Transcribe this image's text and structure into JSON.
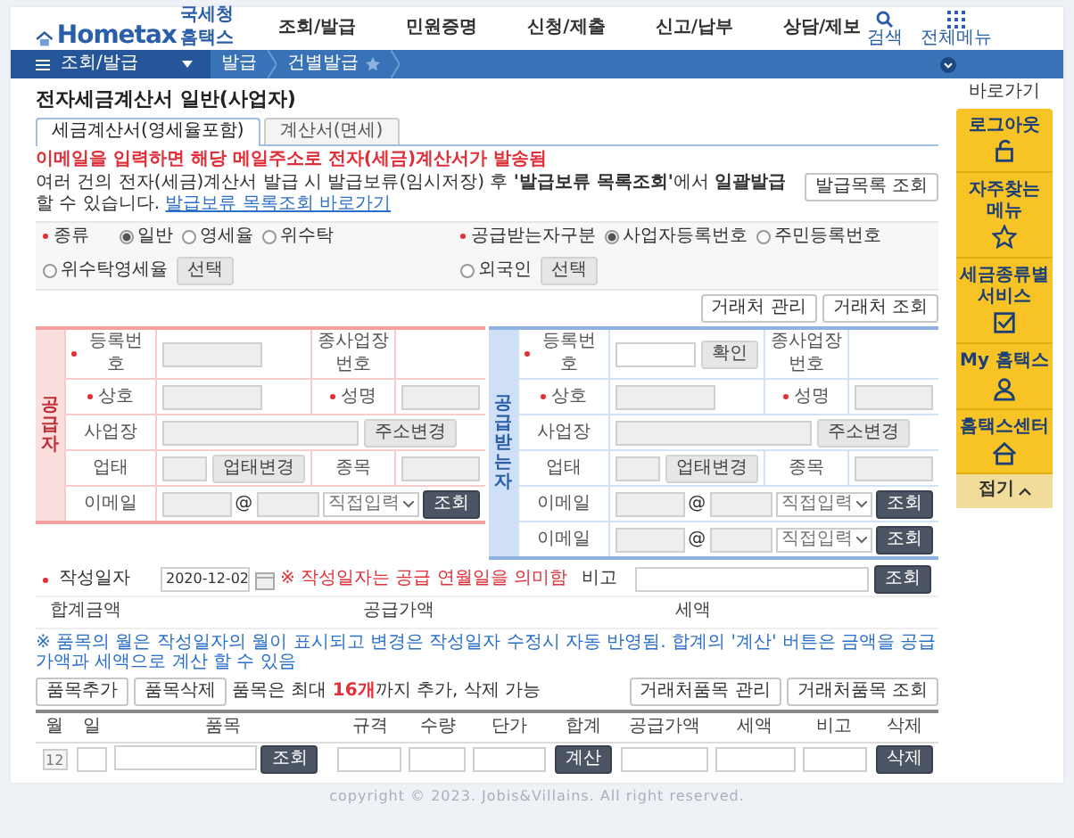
{
  "header": {
    "logo": {
      "name": "Hometax",
      "subtitle": "국세청홈택스"
    },
    "nav": [
      "조회/발급",
      "민원증명",
      "신청/제출",
      "신고/납부",
      "상담/제보"
    ],
    "utilities": [
      {
        "kind": "search",
        "label": "검색"
      },
      {
        "kind": "menu",
        "label": "전체메뉴"
      }
    ]
  },
  "breadcrumb": {
    "menu": "조회/발급",
    "items": [
      "발급",
      "건별발급"
    ]
  },
  "page_title": "전자세금계산서 일반(사업자)",
  "tabs": [
    {
      "label": "세금계산서(영세율포함)",
      "selected": true
    },
    {
      "label": "계산서(면세)",
      "selected": false
    }
  ],
  "notices": {
    "email": "이메일을 입력하면 해당 메일주소로 전자(세금)계산서가 발송됨",
    "info": "여러 건의 전자(세금)계산서 발급 시 발급보류(임시저장) 후 **'발급보류 목록조회'**에서 **일괄발급**할 수 있습니다.",
    "info_link": "발급보류 목록조회 바로가기"
  },
  "issued_list_button": "발급목록 조회",
  "invoice_type": {
    "label": "종류",
    "required": true,
    "button": "선택",
    "options": [
      {
        "label": "일반",
        "selected": true
      },
      {
        "label": "영세율",
        "selected": false
      },
      {
        "label": "위수탁",
        "selected": false
      },
      {
        "label": "위수탁영세율",
        "selected": false
      }
    ]
  },
  "recipient_type": {
    "label": "공급받는자구분",
    "required": true,
    "button": "선택",
    "options": [
      {
        "label": "사업자등록번호",
        "selected": true
      },
      {
        "label": "주민등록번호",
        "selected": false
      },
      {
        "label": "외국인",
        "selected": false
      }
    ]
  },
  "partner_buttons": [
    "거래처 관리",
    "거래처 조회"
  ],
  "parties": [
    {
      "kind": "supplier",
      "title": "공급자",
      "reg_no": {
        "label": "등록번호",
        "required": true
      },
      "sub_no": {
        "label": "종사업장번호"
      },
      "company": {
        "label": "상호",
        "required": true
      },
      "representative": {
        "label": "성명",
        "required": true
      },
      "address": {
        "label": "사업장",
        "button": "주소변경"
      },
      "business": {
        "label": "업태",
        "button": "업태변경"
      },
      "item": {
        "label": "종목"
      },
      "emails": [
        {
          "label": "이메일",
          "at": "@",
          "domain": "직접입력",
          "button": "조회"
        }
      ]
    },
    {
      "kind": "recipient",
      "title": "공급받는자",
      "reg_no": {
        "label": "등록번호",
        "required": true
      },
      "confirm_button": "확인",
      "sub_no": {
        "label": "종사업장번호"
      },
      "company": {
        "label": "상호",
        "required": true
      },
      "representative": {
        "label": "성명",
        "required": true
      },
      "address": {
        "label": "사업장",
        "button": "주소변경"
      },
      "business": {
        "label": "업태",
        "button": "업태변경"
      },
      "item": {
        "label": "종목"
      },
      "emails": [
        {
          "label": "이메일",
          "at": "@",
          "domain": "직접입력",
          "button": "조회"
        },
        {
          "label": "이메일",
          "at": "@",
          "domain": "직접입력",
          "button": "조회"
        }
      ]
    }
  ],
  "issue_date": {
    "label": "작성일자",
    "required": true,
    "value": "2020-12-02",
    "note": "※ 작성일자는 공급 연월일을 의미함"
  },
  "remark": {
    "label": "비고",
    "button": "조회"
  },
  "totals": [
    "합계금액",
    "공급가액",
    "세액"
  ],
  "items_notice": "※ 품목의 월은 작성일자의 월이 표시되고 변경은 작성일자 수정시 자동 반영됨. 합계의 '계산' 버튼은 금액을 공급가액과 세액으로 계산 할 수 있음",
  "item_buttons": [
    "품목추가",
    "품목삭제"
  ],
  "item_limit": "품목은 최대 **16개**까지 추가, 삭제 가능",
  "item_partner_buttons": [
    "거래처품목 관리",
    "거래처품목 조회"
  ],
  "items_table": {
    "columns": [
      "월",
      "일",
      "품목",
      "규격",
      "수량",
      "단가",
      "합계",
      "공급가액",
      "세액",
      "비고",
      "삭제"
    ],
    "rows": [
      {
        "month": "12",
        "search_button": "조회",
        "calc_button": "계산",
        "delete_button": "삭제"
      }
    ]
  },
  "sidebar": {
    "title": "바로가기",
    "items": [
      {
        "kind": "lock",
        "label": "로그아웃"
      },
      {
        "kind": "star",
        "label": "자주찾는 메뉴"
      },
      {
        "kind": "check",
        "label": "세금종류별 서비스"
      },
      {
        "kind": "person",
        "label": "My 홈택스"
      },
      {
        "kind": "house",
        "label": "홈택스센터"
      }
    ],
    "collapse": "접기"
  },
  "footer": "copyright © 2023. Jobis&Villains. All right reserved."
}
